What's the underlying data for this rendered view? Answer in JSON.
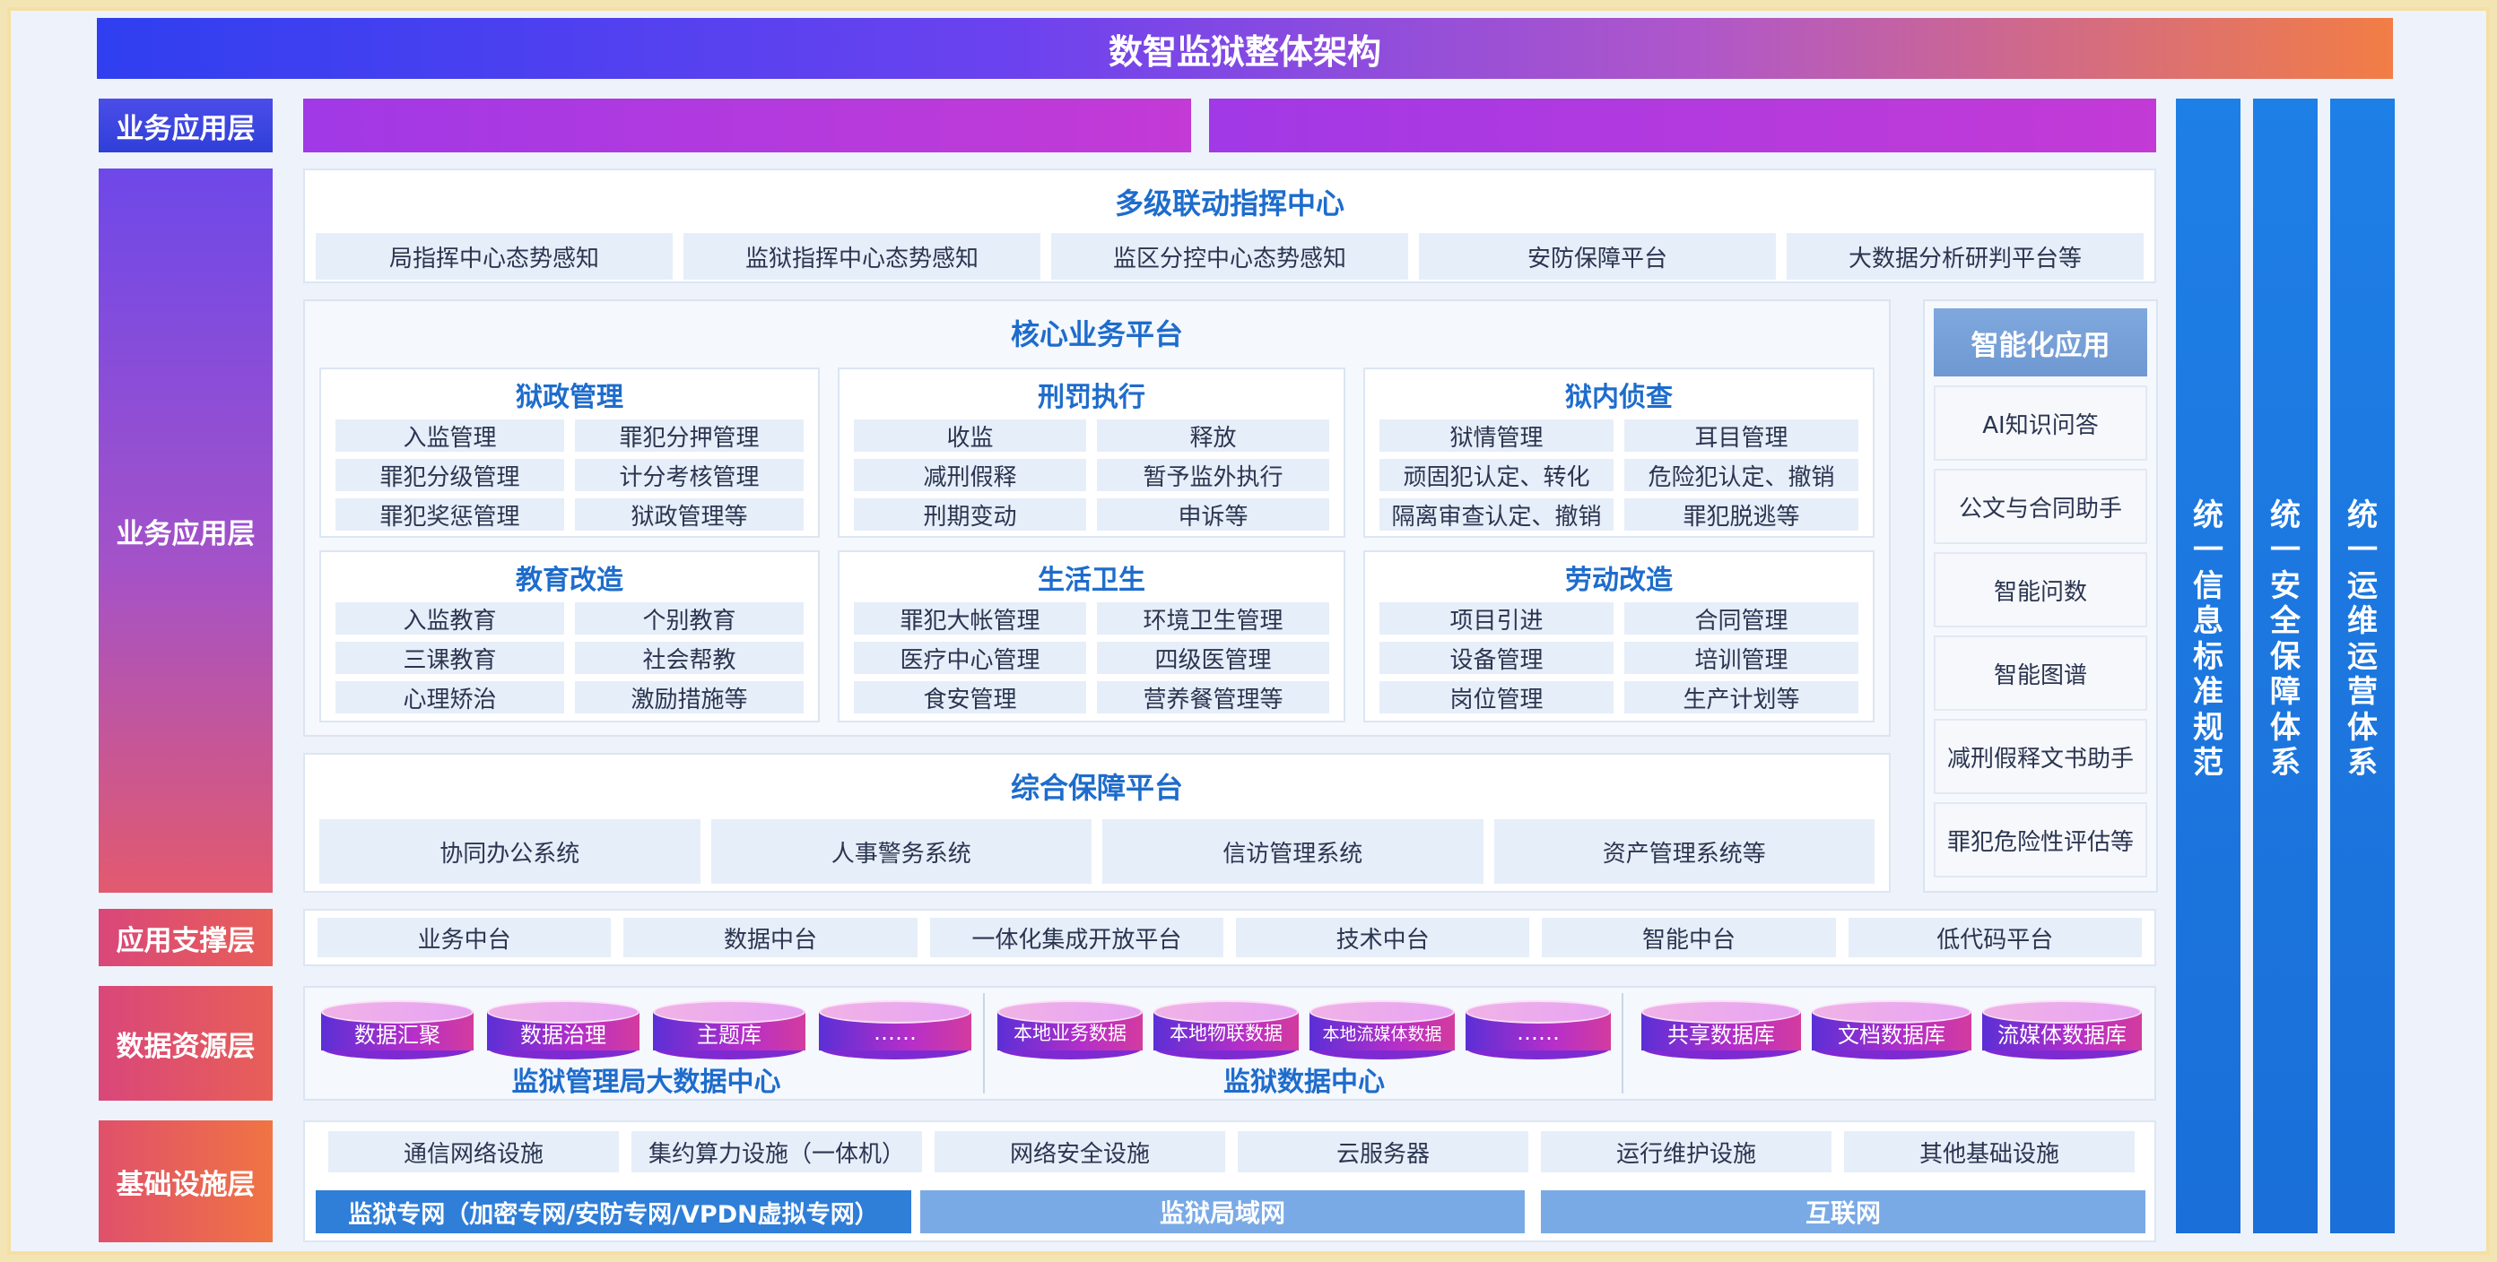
{
  "title": "数智监狱整体架构",
  "layers": {
    "top": "业务应用层",
    "business": "业务应用层",
    "support": "应用支撑层",
    "data": "数据资源层",
    "infra": "基础设施层"
  },
  "command_center": {
    "title": "多级联动指挥中心",
    "items": [
      "局指挥中心态势感知",
      "监狱指挥中心态势感知",
      "监区分控中心态势感知",
      "安防保障平台",
      "大数据分析研判平台等"
    ]
  },
  "core_platform": {
    "title": "核心业务平台",
    "modules": [
      {
        "title": "狱政管理",
        "items": [
          "入监管理",
          "罪犯分押管理",
          "罪犯分级管理",
          "计分考核管理",
          "罪犯奖惩管理",
          "狱政管理等"
        ]
      },
      {
        "title": "刑罚执行",
        "items": [
          "收监",
          "释放",
          "减刑假释",
          "暂予监外执行",
          "刑期变动",
          "申诉等"
        ]
      },
      {
        "title": "狱内侦查",
        "items": [
          "狱情管理",
          "耳目管理",
          "顽固犯认定、转化",
          "危险犯认定、撤销",
          "隔离审查认定、撤销",
          "罪犯脱逃等"
        ]
      },
      {
        "title": "教育改造",
        "items": [
          "入监教育",
          "个别教育",
          "三课教育",
          "社会帮教",
          "心理矫治",
          "激励措施等"
        ]
      },
      {
        "title": "生活卫生",
        "items": [
          "罪犯大帐管理",
          "环境卫生管理",
          "医疗中心管理",
          "四级医管理",
          "食安管理",
          "营养餐管理等"
        ]
      },
      {
        "title": "劳动改造",
        "items": [
          "项目引进",
          "合同管理",
          "设备管理",
          "培训管理",
          "岗位管理",
          "生产计划等"
        ]
      }
    ]
  },
  "support_platform": {
    "title": "综合保障平台",
    "items": [
      "协同办公系统",
      "人事警务系统",
      "信访管理系统",
      "资产管理系统等"
    ]
  },
  "smart_apps": {
    "title": "智能化应用",
    "items": [
      "AI知识问答",
      "公文与合同助手",
      "智能问数",
      "智能图谱",
      "减刑假释文书助手",
      "罪犯危险性评估等"
    ]
  },
  "side_columns": [
    "统一信息标准规范",
    "统一安全保障体系",
    "统一运维运营体系"
  ],
  "support_layer": [
    "业务中台",
    "数据中台",
    "一体化集成开放平台",
    "技术中台",
    "智能中台",
    "低代码平台"
  ],
  "data_layer": {
    "group1": {
      "label": "监狱管理局大数据中心",
      "dbs": [
        "数据汇聚",
        "数据治理",
        "主题库",
        "……"
      ]
    },
    "group2": {
      "label": "监狱数据中心",
      "dbs": [
        "本地业务数据",
        "本地物联数据",
        "本地流媒体数据",
        "……"
      ]
    },
    "group3": {
      "dbs": [
        "共享数据库",
        "文档数据库",
        "流媒体数据库"
      ]
    }
  },
  "infra_layer": {
    "items": [
      "通信网络设施",
      "集约算力设施（一体机）",
      "网络安全设施",
      "云服务器",
      "运行维护设施",
      "其他基础设施"
    ],
    "networks": [
      "监狱专网（加密专网/安防专网/VPDN虚拟专网）",
      "监狱局域网",
      "互联网"
    ]
  },
  "colors": {
    "title_start": "#2f3ff0",
    "title_end": "#f27d45",
    "accent_blue": "#1e6ccc",
    "side_column": "#1e7fe6",
    "db_purple": "#b62fc9"
  }
}
